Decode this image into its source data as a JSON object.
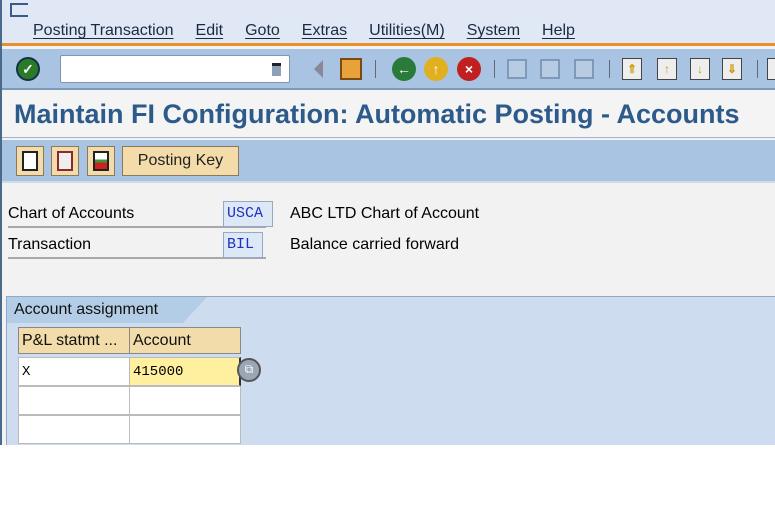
{
  "menubar": {
    "items": [
      "Posting Transaction",
      "Edit",
      "Goto",
      "Extras",
      "Utilities(M)",
      "System",
      "Help"
    ]
  },
  "toolbar": {
    "command_field_value": "",
    "icons": [
      "enter-icon",
      "history-icon",
      "back-arrow-icon",
      "save-icon",
      "back-icon",
      "exit-icon",
      "cancel-icon",
      "print-icon",
      "find-icon",
      "find-next-icon",
      "first-page-icon",
      "previous-page-icon",
      "next-page-icon",
      "last-page-icon"
    ]
  },
  "title": "Maintain FI Configuration: Automatic Posting - Accounts",
  "app_toolbar": {
    "posting_key_label": "Posting Key",
    "icons": [
      "new-entries-icon",
      "copy-icon",
      "delete-icon"
    ]
  },
  "fields": [
    {
      "label": "Chart of Accounts",
      "value": "USCA",
      "description": "ABC LTD Chart of Account"
    },
    {
      "label": "Transaction",
      "value": "BIL",
      "description": "Balance carried forward"
    }
  ],
  "tab": {
    "label": "Account assignment"
  },
  "table": {
    "columns": [
      "P&L statmt ...",
      "Account"
    ],
    "rows": [
      [
        "X",
        "415000"
      ],
      [
        "",
        ""
      ],
      [
        "",
        ""
      ]
    ]
  },
  "colors": {
    "menubar": "#dfe8f4",
    "accent": "#e8912a",
    "toolbar": "#a9c4e2",
    "title": "#2c5a8a",
    "button": "#f3dcaa",
    "active_cell": "#fff0a0"
  }
}
